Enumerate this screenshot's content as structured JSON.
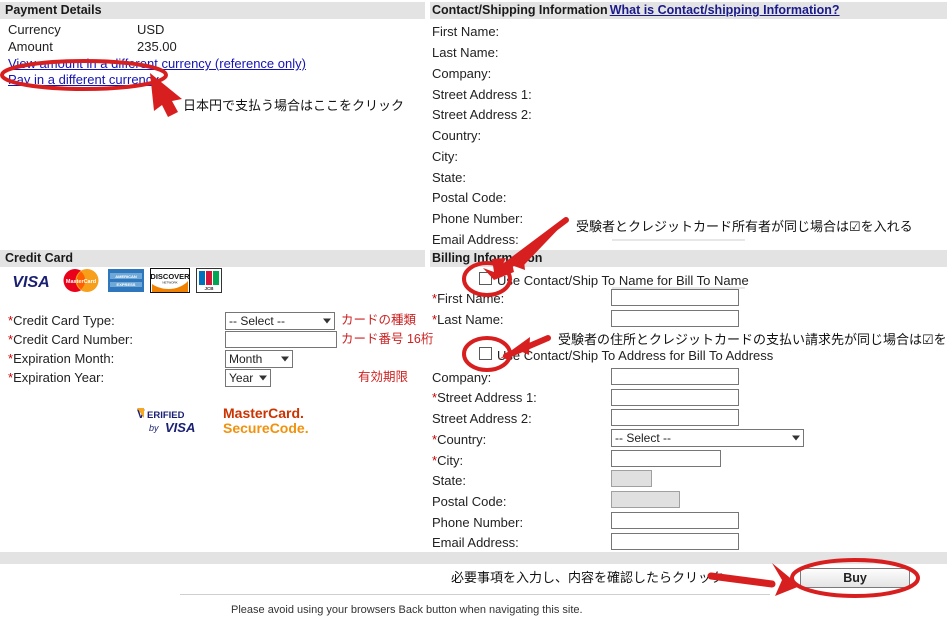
{
  "payment": {
    "header": "Payment Details",
    "rows": [
      {
        "label": "Currency",
        "value": "USD"
      },
      {
        "label": "Amount",
        "value": "235.00"
      }
    ],
    "link_view": "View amount in a different currency (reference only)",
    "link_pay": "Pay in a different currency",
    "annotation_pay": "日本円で支払う場合はここをクリック"
  },
  "contact": {
    "header": "Contact/Shipping Information",
    "header_link": "What is Contact/shipping Information?",
    "labels": [
      "First Name:",
      "Last Name:",
      "Company:",
      "Street Address 1:",
      "Street Address 2:",
      "Country:",
      "City:",
      "State:",
      "Postal Code:",
      "Phone Number:",
      "Email Address:"
    ]
  },
  "credit_card": {
    "header": "Credit Card",
    "logos": [
      "visa-logo",
      "mastercard-logo",
      "amex-logo",
      "discover-logo",
      "jcb-logo"
    ],
    "secure_logos": [
      "verified-by-visa-logo",
      "mastercard-securecode-logo"
    ],
    "fields": [
      {
        "label": "Credit Card Type:",
        "required": true,
        "control": "select",
        "value": "-- Select --",
        "note": "カードの種類"
      },
      {
        "label": "Credit Card Number:",
        "required": true,
        "control": "text",
        "value": "",
        "note": "カード番号 16桁"
      },
      {
        "label": "Expiration Month:",
        "required": true,
        "control": "select",
        "value": "Month",
        "note": ""
      },
      {
        "label": "Expiration Year:",
        "required": true,
        "control": "select",
        "value": "Year",
        "note": "有効期限"
      }
    ]
  },
  "billing": {
    "header": "Billing Information",
    "checkbox_name": {
      "label": "Use Contact/Ship To Name for Bill To Name",
      "checked": false,
      "annotation": "受験者とクレジットカード所有者が同じ場合は☑を入れる"
    },
    "checkbox_address": {
      "label": "Use Contact/Ship To Address for Bill To Address",
      "checked": false,
      "annotation": "受験者の住所とクレジットカードの支払い請求先が同じ場合は☑を入れる"
    },
    "fields": [
      {
        "label": "First Name:",
        "required": true,
        "control": "text",
        "value": "",
        "disabled": false
      },
      {
        "label": "Last Name:",
        "required": true,
        "control": "text",
        "value": "",
        "disabled": false
      },
      {
        "label": "Company:",
        "required": false,
        "control": "text",
        "value": "",
        "disabled": false
      },
      {
        "label": "Street Address 1:",
        "required": true,
        "control": "text",
        "value": "",
        "disabled": false
      },
      {
        "label": "Street Address 2:",
        "required": false,
        "control": "text",
        "value": "",
        "disabled": false
      },
      {
        "label": "Country:",
        "required": true,
        "control": "select",
        "value": "-- Select --",
        "disabled": false
      },
      {
        "label": "City:",
        "required": true,
        "control": "text",
        "value": "",
        "disabled": false
      },
      {
        "label": "State:",
        "required": false,
        "control": "text",
        "value": "",
        "disabled": true
      },
      {
        "label": "Postal Code:",
        "required": false,
        "control": "text",
        "value": "",
        "disabled": true
      },
      {
        "label": "Phone Number:",
        "required": false,
        "control": "text",
        "value": "",
        "disabled": false
      },
      {
        "label": "Email Address:",
        "required": false,
        "control": "text",
        "value": "",
        "disabled": false
      }
    ]
  },
  "footer": {
    "buy_label": "Buy",
    "buy_annotation": "必要事項を入力し、内容を確認したらクリック",
    "notice": "Please avoid using your browsers Back button when navigating this site."
  },
  "colors": {
    "header_bar": "#e3e3e3",
    "link": "#1414b4",
    "required_star": "#cc0000",
    "annotation_red": "#cc2222",
    "pen_red": "#d81f1f"
  }
}
